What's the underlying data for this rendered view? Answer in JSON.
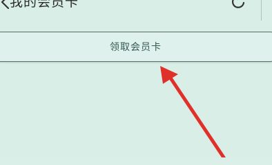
{
  "header": {
    "title": "我的会员卡"
  },
  "main": {
    "claim_card_label": "领取会员卡"
  },
  "colors": {
    "background": "#d8eee7",
    "button_border": "#5b6b66",
    "arrow": "#e0302a"
  },
  "icons": {
    "back": "chevron-left-icon",
    "refresh": "refresh-icon",
    "annotation": "red-arrow-icon"
  }
}
